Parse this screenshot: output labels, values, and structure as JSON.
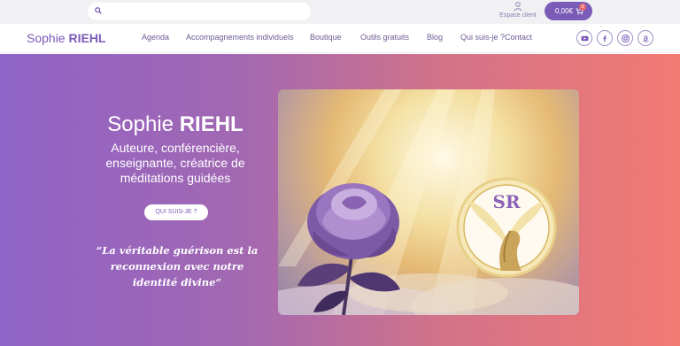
{
  "topbar": {
    "search": {
      "placeholder": "",
      "icon": "search-icon"
    },
    "account": {
      "label": "Espace client",
      "icon": "user-icon"
    },
    "cart": {
      "amount": "0,00€",
      "count": "0",
      "icon": "cart-icon"
    }
  },
  "nav": {
    "logo_first": "Sophie",
    "logo_last": "RIEHL",
    "items": [
      "Agenda",
      "Accompagnements individuels",
      "Boutique",
      "Outils gratuits",
      "Blog",
      "Qui suis-je ?",
      "Contact"
    ],
    "social": [
      "youtube-icon",
      "facebook-icon",
      "instagram-icon",
      "amazon-icon"
    ]
  },
  "hero": {
    "title_first": "Sophie",
    "title_last": "RIEHL",
    "subtitle": "Auteure, conférencière, enseignante, créatrice de méditations guidées",
    "button": "QUI SUIS-JE ?",
    "quote": "“La véritable guérison est la reconnexion avec notre identité divine”",
    "image_monogram": "SR"
  },
  "colors": {
    "accent": "#7b5bb8",
    "gradient_start": "#8f63c7",
    "gradient_end": "#f37a73"
  }
}
